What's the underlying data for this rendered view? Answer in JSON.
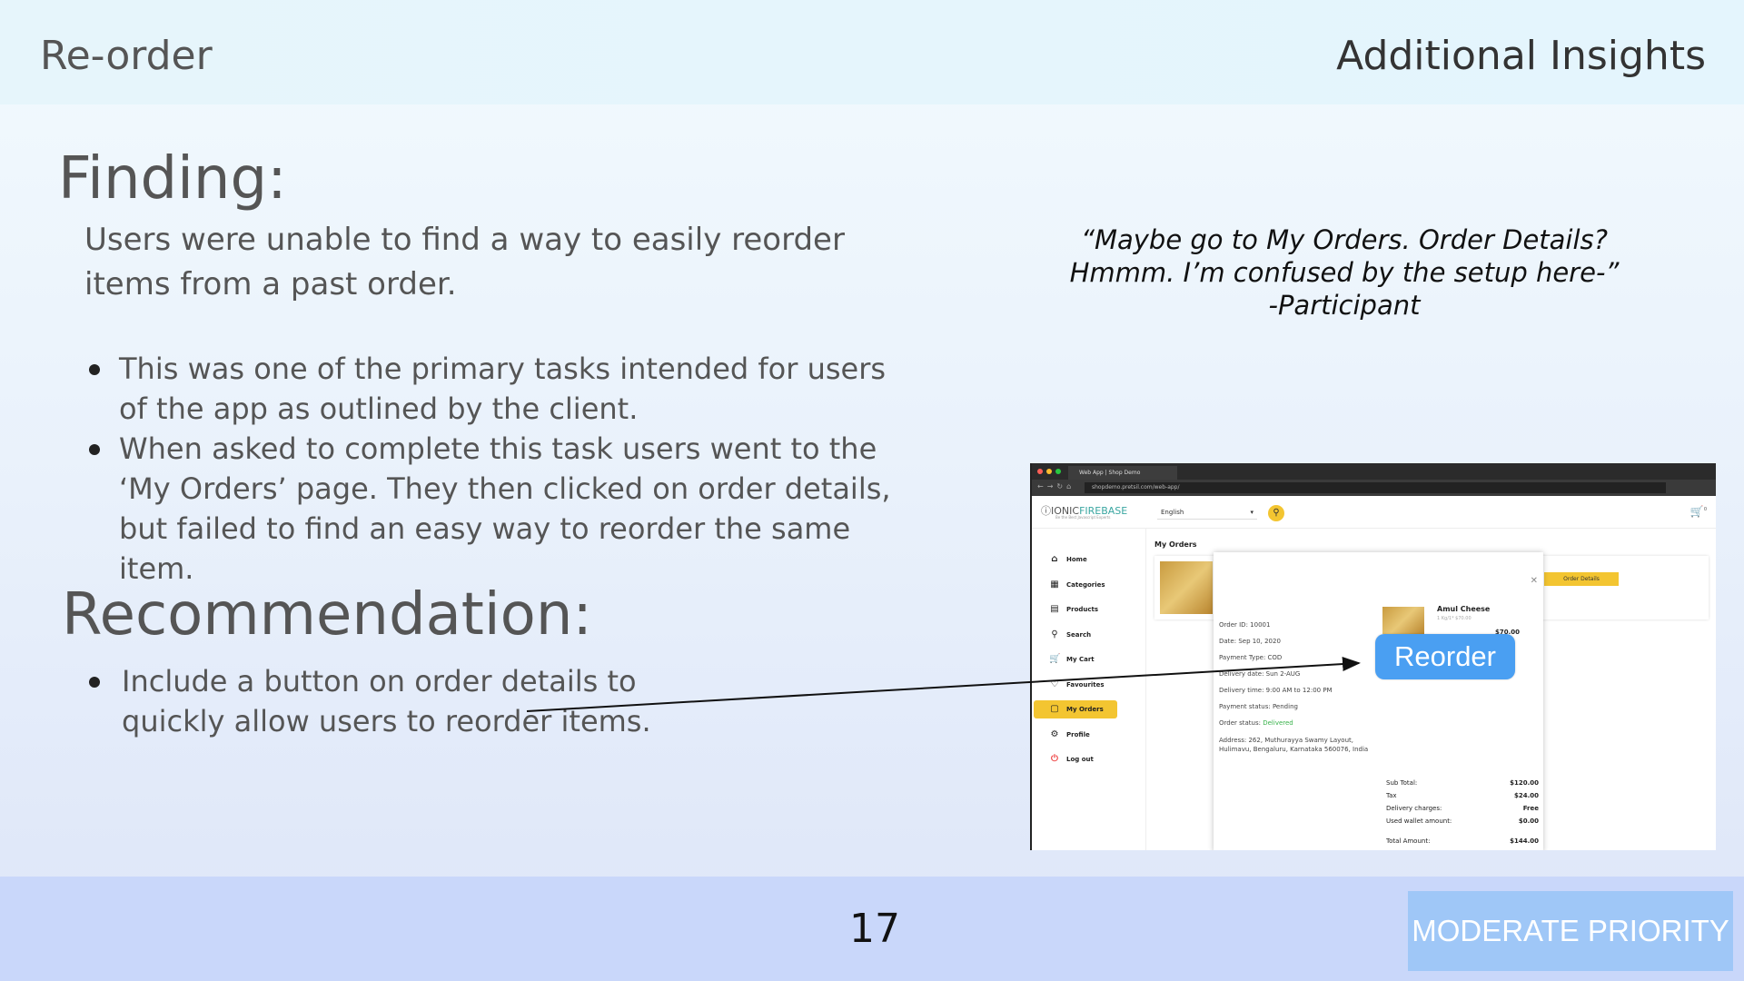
{
  "header": {
    "section": "Re-order",
    "insights": "Additional Insights"
  },
  "finding": {
    "title": "Finding:",
    "text": "Users were unable to find a way to easily reorder items from a past order.",
    "bullets": [
      "This was one of the primary tasks intended for users of the app as outlined by the client.",
      "When asked to complete this task users went to the ‘My Orders’ page.  They then clicked on order details, but failed to find an easy way to reorder the same item."
    ]
  },
  "recommendation": {
    "title": "Recommendation:",
    "bullets": [
      "Include a button on order details to quickly allow users to reorder items."
    ]
  },
  "quote": {
    "line1": "“Maybe go to My Orders.  Order Details?",
    "line2": "Hmmm.  I’m confused by the setup here-”",
    "line3": "-Participant"
  },
  "screenshot": {
    "tab_title": "Web App | Shop Demo",
    "url": "shopdemo.pretsil.com/web-app/",
    "logo_prefix": "IONIC",
    "logo_brand": "FIREBASE",
    "logo_sub": "Be the Best Javascript Experts",
    "language": "English",
    "cart_count": "0",
    "sidebar": [
      {
        "label": "Home",
        "icon": "⌂"
      },
      {
        "label": "Categories",
        "icon": "▦"
      },
      {
        "label": "Products",
        "icon": "▤"
      },
      {
        "label": "Search",
        "icon": "⚲"
      },
      {
        "label": "My Cart",
        "icon": "🛒"
      },
      {
        "label": "Favourites",
        "icon": "♡"
      },
      {
        "label": "My Orders",
        "icon": "▢"
      },
      {
        "label": "Profile",
        "icon": "⚙"
      },
      {
        "label": "Log out",
        "icon": "⏻"
      }
    ],
    "page_title": "My Orders",
    "order_details_button": "Order Details",
    "order": {
      "id": "Order ID: 10001",
      "date": "Date: Sep 10, 2020",
      "payment_type": "Payment Type: COD",
      "delivery_date": "Delivery date: Sun 2-AUG",
      "delivery_time": "Delivery time: 9:00 AM to 12:00 PM",
      "payment_status": "Payment status: Pending",
      "order_status_label": "Order status:",
      "order_status": "Delivered",
      "address": "Address: 262, Muthurayya Swamy Layout, Hulimavu, Bengaluru, Karnataka 560076, India"
    },
    "item": {
      "name": "Amul Cheese",
      "sub": "1 Kg/1* $70.00",
      "price": "$70.00"
    },
    "summary": [
      {
        "k": "Sub Total:",
        "v": "$120.00"
      },
      {
        "k": "Tax",
        "v": "$24.00"
      },
      {
        "k": "Delivery charges:",
        "v": "Free"
      },
      {
        "k": "Used wallet amount:",
        "v": "$0.00"
      },
      {
        "k": "Total Amount:",
        "v": "$144.00"
      }
    ],
    "reorder_label": "Reorder"
  },
  "footer": {
    "page_number": "17",
    "priority": "MODERATE PRIORITY"
  },
  "colors": {
    "accent_yellow": "#f3c531",
    "reorder_blue": "#4a9ff2",
    "priority_bg": "#9fc7f7",
    "footer_bg": "#c9d7fa"
  }
}
